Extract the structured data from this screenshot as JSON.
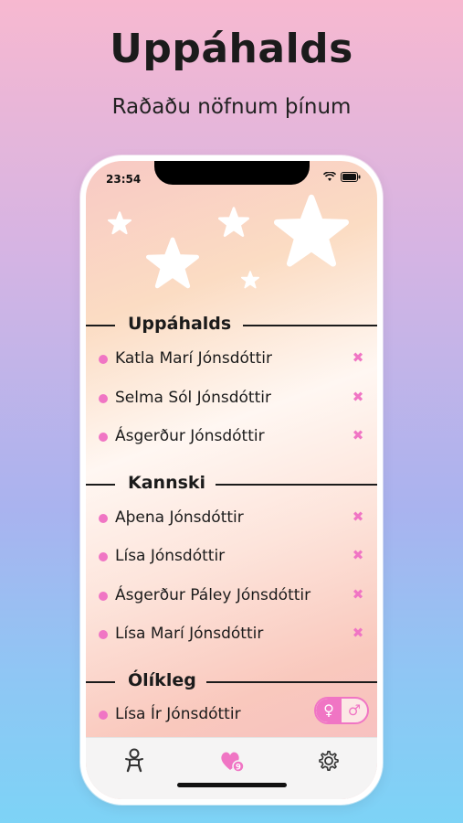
{
  "promo": {
    "headline": "Uppáhalds",
    "subline": "Raðaðu nöfnum þínum"
  },
  "status_bar": {
    "time": "23:54"
  },
  "sections": [
    {
      "title": "Uppáhalds",
      "names": [
        "Katla Marí Jónsdóttir",
        "Selma Sól Jónsdóttir",
        "Ásgerður Jónsdóttir"
      ]
    },
    {
      "title": "Kannski",
      "names": [
        "Aþena Jónsdóttir",
        "Lísa Jónsdóttir",
        "Ásgerður Páley Jónsdóttir",
        "Lísa Marí Jónsdóttir"
      ]
    },
    {
      "title": "Ólíkleg",
      "names": [
        "Lísa Ír Jónsdóttir"
      ]
    }
  ],
  "remove_glyph": "✖",
  "gender_toggle": {
    "female": "♀",
    "male": "♂",
    "selected": "female"
  },
  "tabs": [
    {
      "icon": "baby-icon"
    },
    {
      "icon": "heart-icon",
      "badge": "9",
      "active": true
    },
    {
      "icon": "gear-icon"
    }
  ],
  "colors": {
    "accent": "#f075c4",
    "text": "#1b1b1b"
  }
}
